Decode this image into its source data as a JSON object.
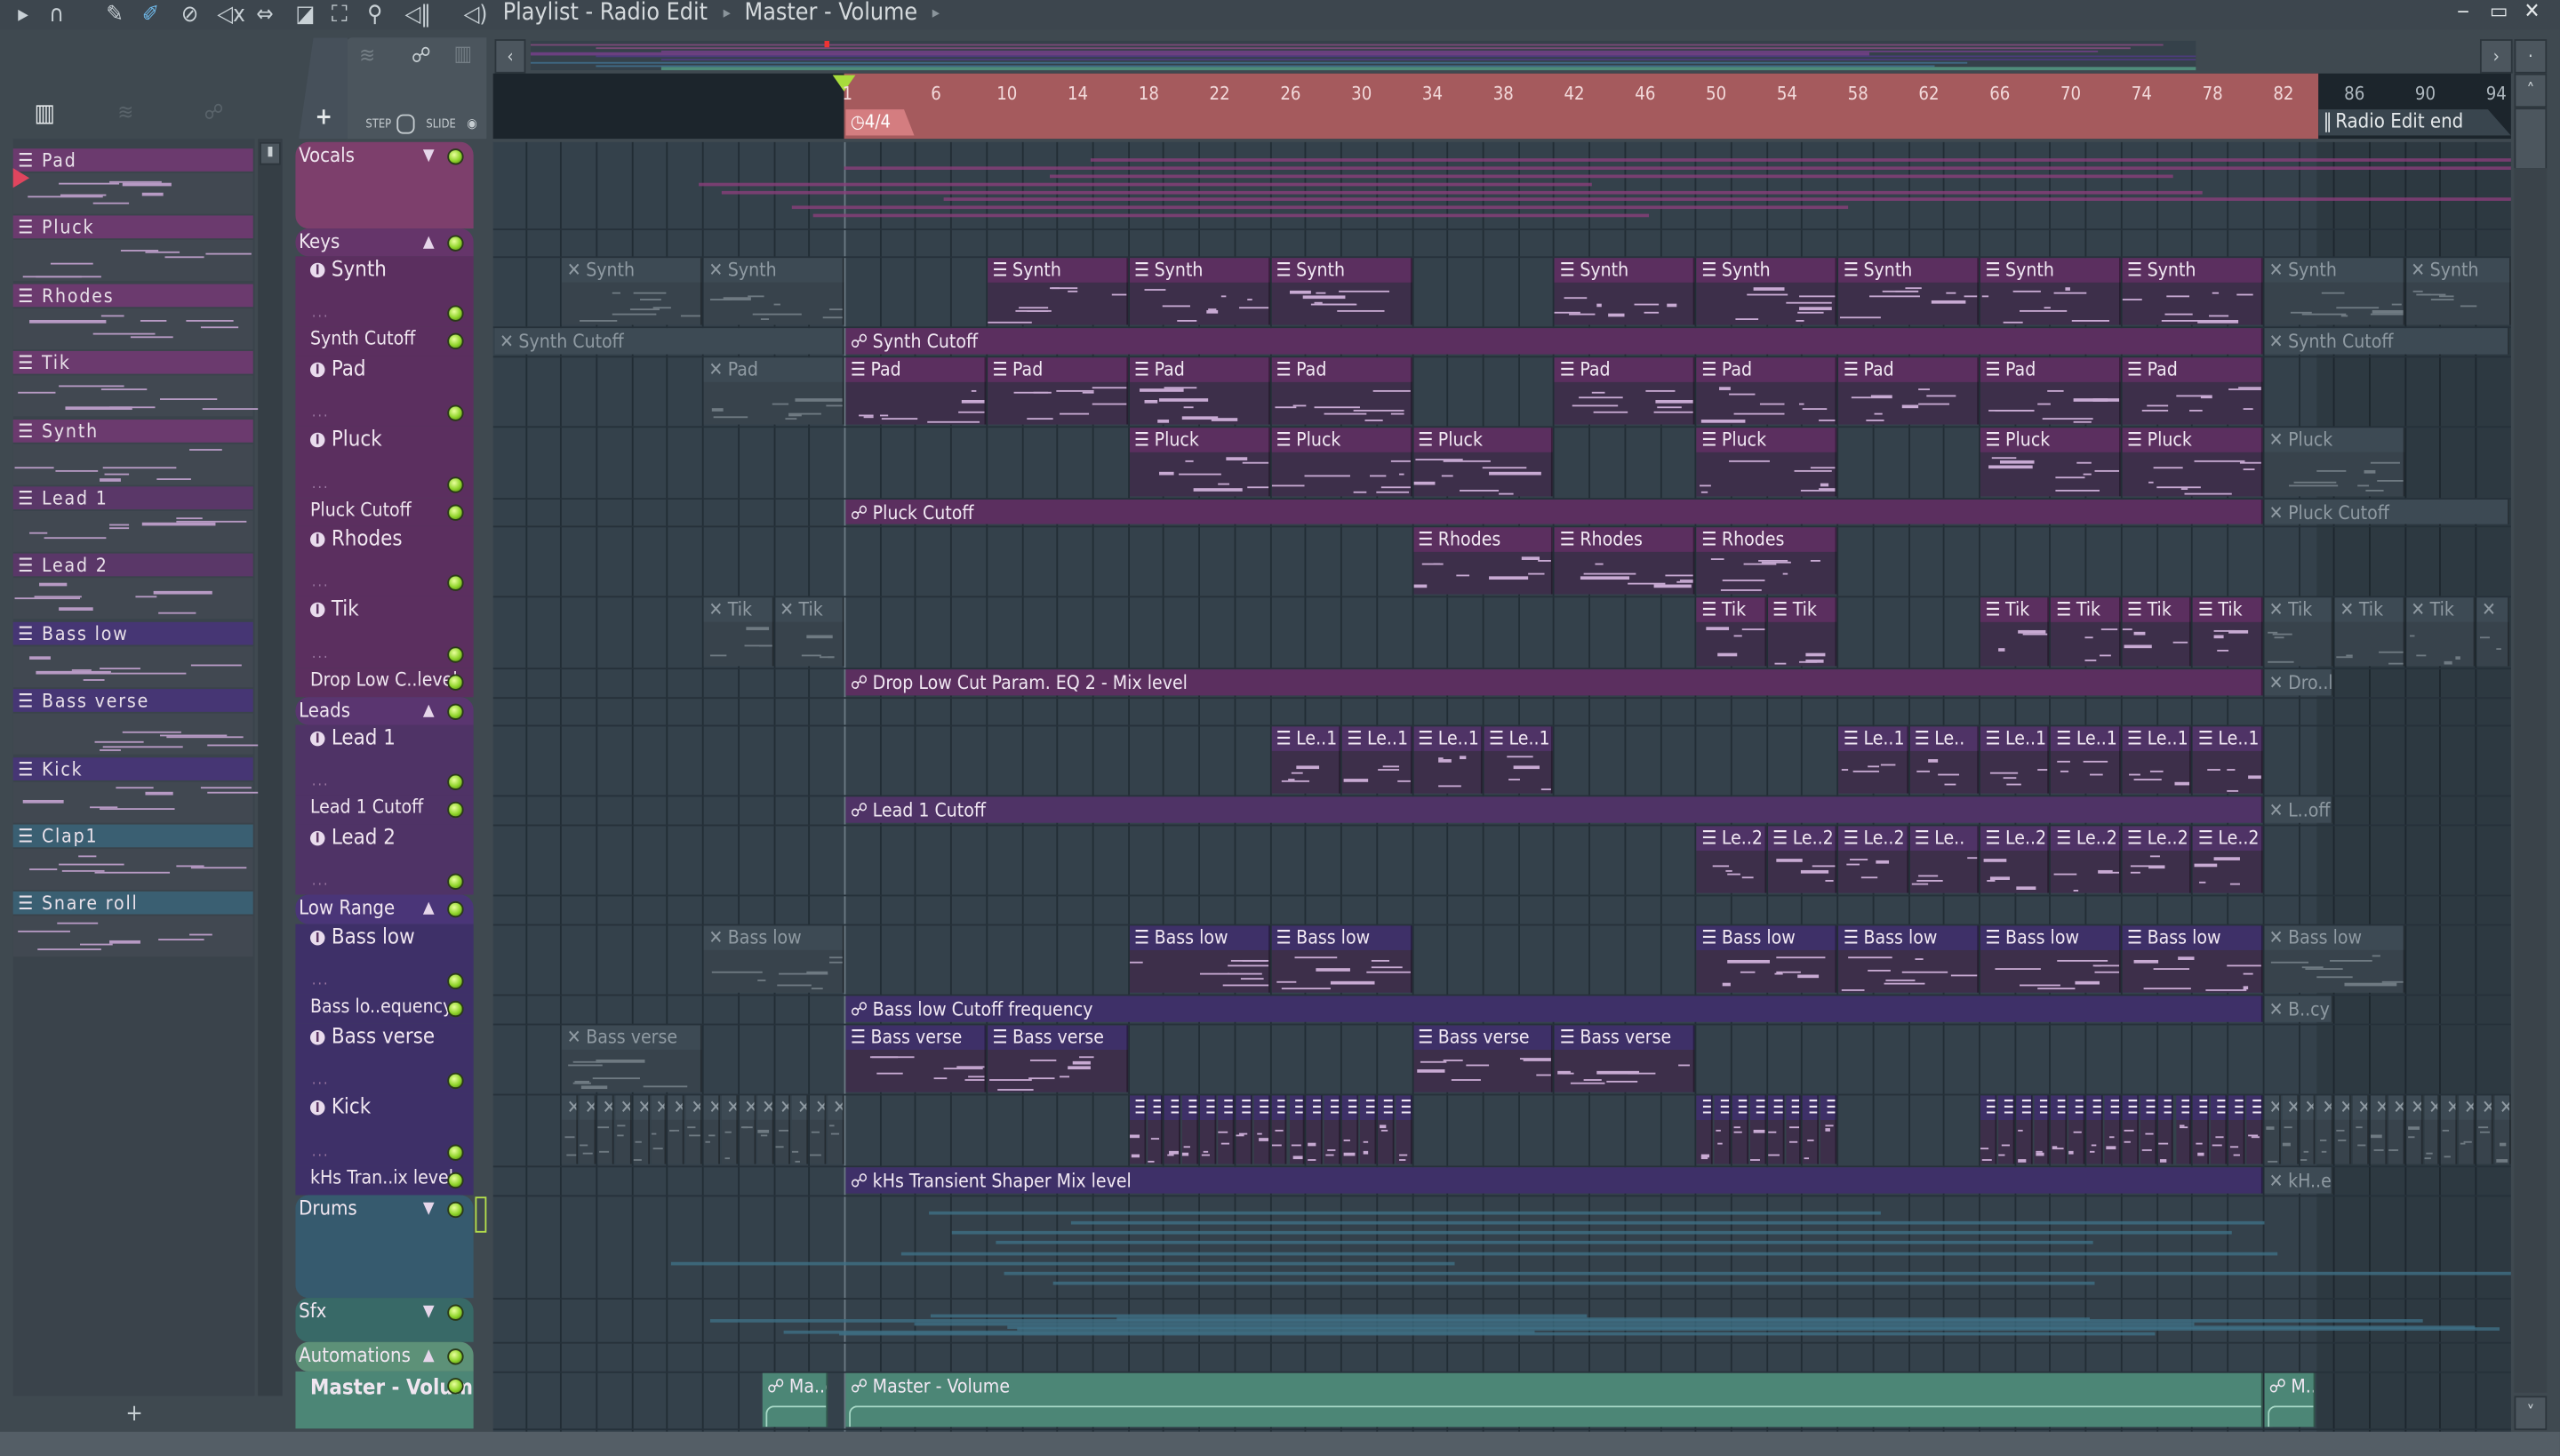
{
  "toolbar": {
    "title": "Playlist - Radio Edit",
    "breadcrumb": "Master - Volume",
    "icons": [
      "play-arrow-icon",
      "magnet-icon",
      "pencil-icon",
      "paint-brush-icon",
      "delete-icon",
      "mute-icon",
      "slip-icon",
      "slice-icon",
      "select-icon",
      "zoom-icon",
      "playback-icon",
      "speaker-icon"
    ]
  },
  "picker": {
    "step_label": "STEP",
    "slide_label": "SLIDE",
    "add_label": "+",
    "items": [
      {
        "label": "Pad",
        "color": "#6b3a6e"
      },
      {
        "label": "Pluck",
        "color": "#6b3a6e"
      },
      {
        "label": "Rhodes",
        "color": "#6b3a6e"
      },
      {
        "label": "Tik",
        "color": "#6b3a6e"
      },
      {
        "label": "Synth",
        "color": "#6b3a6e"
      },
      {
        "label": "Lead 1",
        "color": "#5a3768"
      },
      {
        "label": "Lead 2",
        "color": "#5a3768"
      },
      {
        "label": "Bass low",
        "color": "#463674"
      },
      {
        "label": "Bass verse",
        "color": "#463674"
      },
      {
        "label": "Kick",
        "color": "#463674"
      },
      {
        "label": "Clap1",
        "color": "#3a5f72"
      },
      {
        "label": "Snare roll",
        "color": "#3a5f72"
      }
    ]
  },
  "ruler": {
    "labels": [
      1,
      6,
      10,
      14,
      18,
      22,
      26,
      30,
      34,
      38,
      42,
      46,
      50,
      54,
      58,
      62,
      66,
      70,
      74,
      78,
      82,
      86,
      90,
      94
    ],
    "song_start_bar": 1,
    "song_end_bar": 84,
    "time_signature": "4/4",
    "end_marker": "Radio Edit end"
  },
  "tracks": [
    {
      "name": "Vocals",
      "kind": "group",
      "arrow": "▼",
      "color": "#7d3f6c",
      "clips": []
    },
    {
      "name": "Keys",
      "kind": "group",
      "arrow": "▲",
      "color": "#65356a",
      "clips": []
    },
    {
      "name": "Synth",
      "kind": "pattern",
      "color": "#5b2f5f",
      "clips": [
        {
          "label": "Synth",
          "start": -15,
          "len": 8,
          "muted": true
        },
        {
          "label": "Synth",
          "start": -7,
          "len": 8,
          "muted": true
        },
        {
          "label": "Synth",
          "start": 9,
          "len": 8
        },
        {
          "label": "Synth",
          "start": 17,
          "len": 8
        },
        {
          "label": "Synth",
          "start": 25,
          "len": 8
        },
        {
          "label": "Synth",
          "start": 41,
          "len": 8
        },
        {
          "label": "Synth",
          "start": 49,
          "len": 8
        },
        {
          "label": "Synth",
          "start": 57,
          "len": 8
        },
        {
          "label": "Synth",
          "start": 65,
          "len": 8
        },
        {
          "label": "Synth",
          "start": 73,
          "len": 8
        },
        {
          "label": "Synth",
          "start": 81,
          "len": 8,
          "muted": true
        },
        {
          "label": "Synth",
          "start": 89,
          "len": 6,
          "muted": true
        }
      ]
    },
    {
      "name": "Synth Cutoff",
      "kind": "automation",
      "color": "#5b2f5f",
      "clips": [
        {
          "label": "Synth Cutoff",
          "start": -18.8,
          "len": 19.8,
          "muted": true
        },
        {
          "label": "Synth Cutoff",
          "start": 1,
          "len": 80
        },
        {
          "label": "Synth Cutoff",
          "start": 81,
          "len": 13.9,
          "muted": true
        }
      ]
    },
    {
      "name": "Pad",
      "kind": "pattern",
      "color": "#5b2f5f",
      "clips": [
        {
          "label": "Pad",
          "start": -7,
          "len": 8,
          "muted": true
        },
        {
          "label": "Pad",
          "start": 1,
          "len": 8
        },
        {
          "label": "Pad",
          "start": 9,
          "len": 8
        },
        {
          "label": "Pad",
          "start": 17,
          "len": 8
        },
        {
          "label": "Pad",
          "start": 25,
          "len": 8
        },
        {
          "label": "Pad",
          "start": 41,
          "len": 8
        },
        {
          "label": "Pad",
          "start": 49,
          "len": 8
        },
        {
          "label": "Pad",
          "start": 57,
          "len": 8
        },
        {
          "label": "Pad",
          "start": 65,
          "len": 8
        },
        {
          "label": "Pad",
          "start": 73,
          "len": 8
        }
      ]
    },
    {
      "name": "Pluck",
      "kind": "pattern",
      "color": "#5b2f5f",
      "clips": [
        {
          "label": "Pluck",
          "start": 17,
          "len": 8
        },
        {
          "label": "Pluck",
          "start": 25,
          "len": 8
        },
        {
          "label": "Pluck",
          "start": 33,
          "len": 8
        },
        {
          "label": "Pluck",
          "start": 49,
          "len": 8
        },
        {
          "label": "Pluck",
          "start": 65,
          "len": 8
        },
        {
          "label": "Pluck",
          "start": 73,
          "len": 8
        },
        {
          "label": "Pluck",
          "start": 81,
          "len": 8,
          "muted": true
        }
      ]
    },
    {
      "name": "Pluck Cutoff",
      "kind": "automation",
      "color": "#5b2f5f",
      "clips": [
        {
          "label": "Pluck Cutoff",
          "start": 1,
          "len": 80
        },
        {
          "label": "Pluck Cutoff",
          "start": 81,
          "len": 13.9,
          "muted": true
        }
      ]
    },
    {
      "name": "Rhodes",
      "kind": "pattern",
      "color": "#5b2f5f",
      "clips": [
        {
          "label": "Rhodes",
          "start": 33,
          "len": 8
        },
        {
          "label": "Rhodes",
          "start": 41,
          "len": 8
        },
        {
          "label": "Rhodes",
          "start": 49,
          "len": 8
        }
      ]
    },
    {
      "name": "Tik",
      "kind": "pattern",
      "color": "#5b2f5f",
      "clips": [
        {
          "label": "Tik",
          "start": -7,
          "len": 4,
          "muted": true
        },
        {
          "label": "Tik",
          "start": -3,
          "len": 4,
          "muted": true
        },
        {
          "label": "Tik",
          "start": 49,
          "len": 4
        },
        {
          "label": "Tik",
          "start": 53,
          "len": 4
        },
        {
          "label": "Tik",
          "start": 65,
          "len": 4
        },
        {
          "label": "Tik",
          "start": 69,
          "len": 4
        },
        {
          "label": "Tik",
          "start": 73,
          "len": 4
        },
        {
          "label": "Tik",
          "start": 77,
          "len": 4
        },
        {
          "label": "Tik",
          "start": 81,
          "len": 4,
          "muted": true
        },
        {
          "label": "Tik",
          "start": 85,
          "len": 4,
          "muted": true
        },
        {
          "label": "Tik",
          "start": 89,
          "len": 4,
          "muted": true
        },
        {
          "label": "",
          "start": 93,
          "len": 1.9,
          "muted": true
        }
      ]
    },
    {
      "name": "Drop Low C..level",
      "kind": "automation",
      "color": "#5b2f5f",
      "clips": [
        {
          "label": "Drop Low Cut Param. EQ 2 - Mix level",
          "start": 1,
          "len": 80
        },
        {
          "label": "Dro..l",
          "start": 81,
          "len": 4,
          "muted": true
        }
      ]
    },
    {
      "name": "Leads",
      "kind": "group",
      "arrow": "▲",
      "color": "#5a3570",
      "clips": []
    },
    {
      "name": "Lead 1",
      "kind": "pattern",
      "color": "#4f3366",
      "clips": [
        {
          "label": "Le..1",
          "start": 25,
          "len": 4
        },
        {
          "label": "Le..1",
          "start": 29,
          "len": 4
        },
        {
          "label": "Le..1",
          "start": 33,
          "len": 4
        },
        {
          "label": "Le..1",
          "start": 37,
          "len": 4
        },
        {
          "label": "Le..1",
          "start": 57,
          "len": 4
        },
        {
          "label": "Le..",
          "start": 61,
          "len": 4
        },
        {
          "label": "Le..1",
          "start": 65,
          "len": 4
        },
        {
          "label": "Le..1",
          "start": 69,
          "len": 4
        },
        {
          "label": "Le..1",
          "start": 73,
          "len": 4
        },
        {
          "label": "Le..1",
          "start": 77,
          "len": 4
        }
      ]
    },
    {
      "name": "Lead 1 Cutoff",
      "kind": "automation",
      "color": "#4f3366",
      "clips": [
        {
          "label": "Lead 1 Cutoff",
          "start": 1,
          "len": 80
        },
        {
          "label": "L..off",
          "start": 81,
          "len": 4,
          "muted": true
        }
      ]
    },
    {
      "name": "Lead 2",
      "kind": "pattern",
      "color": "#4f3366",
      "clips": [
        {
          "label": "Le..2",
          "start": 49,
          "len": 4
        },
        {
          "label": "Le..2",
          "start": 53,
          "len": 4
        },
        {
          "label": "Le..2",
          "start": 57,
          "len": 4
        },
        {
          "label": "Le..",
          "start": 61,
          "len": 4
        },
        {
          "label": "Le..2",
          "start": 65,
          "len": 4
        },
        {
          "label": "Le..2",
          "start": 69,
          "len": 4
        },
        {
          "label": "Le..2",
          "start": 73,
          "len": 4
        },
        {
          "label": "Le..2",
          "start": 77,
          "len": 4
        }
      ]
    },
    {
      "name": "Low Range",
      "kind": "group",
      "arrow": "▲",
      "color": "#4a3578",
      "clips": []
    },
    {
      "name": "Bass low",
      "kind": "pattern",
      "color": "#3e3068",
      "clips": [
        {
          "label": "Bass low",
          "start": -7,
          "len": 8,
          "muted": true
        },
        {
          "label": "Bass low",
          "start": 17,
          "len": 8
        },
        {
          "label": "Bass low",
          "start": 25,
          "len": 8
        },
        {
          "label": "Bass low",
          "start": 49,
          "len": 8
        },
        {
          "label": "Bass low",
          "start": 57,
          "len": 8
        },
        {
          "label": "Bass low",
          "start": 65,
          "len": 8
        },
        {
          "label": "Bass low",
          "start": 73,
          "len": 8
        },
        {
          "label": "Bass low",
          "start": 81,
          "len": 8,
          "muted": true
        }
      ]
    },
    {
      "name": "Bass lo..equency",
      "kind": "automation",
      "color": "#3e3068",
      "clips": [
        {
          "label": "Bass low Cutoff frequency",
          "start": 1,
          "len": 80
        },
        {
          "label": "B..cy",
          "start": 81,
          "len": 4,
          "muted": true
        }
      ]
    },
    {
      "name": "Bass verse",
      "kind": "pattern",
      "color": "#3e3068",
      "clips": [
        {
          "label": "Bass verse",
          "start": -15,
          "len": 8,
          "muted": true
        },
        {
          "label": "Bass verse",
          "start": 1,
          "len": 8
        },
        {
          "label": "Bass verse",
          "start": 9,
          "len": 8
        },
        {
          "label": "Bass verse",
          "start": 33,
          "len": 8
        },
        {
          "label": "Bass verse",
          "start": 41,
          "len": 8
        }
      ]
    },
    {
      "name": "Kick",
      "kind": "pattern",
      "color": "#3e3068",
      "repeat_clips": [
        {
          "start": -15,
          "count": 8,
          "muted": true
        },
        {
          "start": -7,
          "count": 8,
          "muted": true
        },
        {
          "start": 17,
          "count": 16
        },
        {
          "start": 49,
          "count": 8
        },
        {
          "start": 65,
          "count": 16
        },
        {
          "start": 81,
          "count": 8,
          "muted": true
        },
        {
          "start": 89,
          "count": 6,
          "muted": true
        }
      ],
      "clips": []
    },
    {
      "name": "kHs Tran..ix level",
      "kind": "automation",
      "color": "#3e3068",
      "clips": [
        {
          "label": "kHs Transient Shaper Mix level",
          "start": 1,
          "len": 80
        },
        {
          "label": "kH..el",
          "start": 81,
          "len": 4,
          "muted": true
        }
      ]
    },
    {
      "name": "Drums",
      "kind": "group",
      "arrow": "▼",
      "color": "#365a6e",
      "clips": []
    },
    {
      "name": "Sfx",
      "kind": "group",
      "arrow": "▼",
      "color": "#386967",
      "clips": []
    },
    {
      "name": "Automations",
      "kind": "group",
      "arrow": "▲",
      "color": "#5d9178",
      "clips": []
    },
    {
      "name": "Master - Volume",
      "kind": "automation",
      "color": "#4c8676",
      "clips": [
        {
          "label": "Ma..e",
          "start": -3.7,
          "len": 3.8
        },
        {
          "label": "Master - Volume",
          "start": 1,
          "len": 80
        },
        {
          "label": "M..",
          "start": 81,
          "len": 3
        }
      ]
    }
  ]
}
